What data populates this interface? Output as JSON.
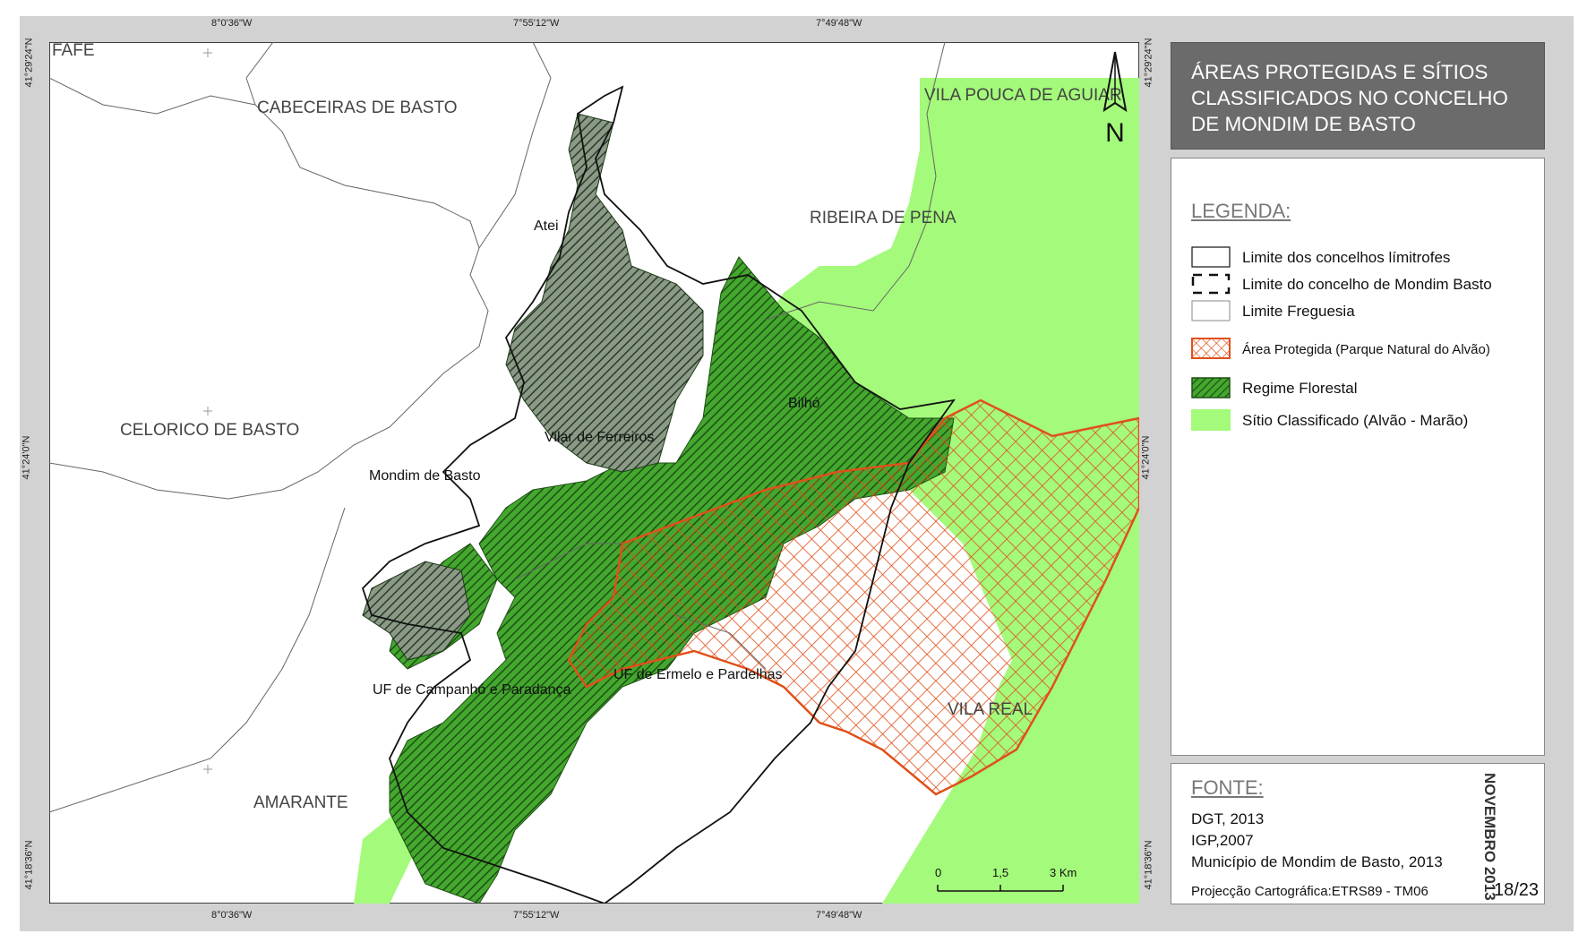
{
  "title": "ÁREAS PROTEGIDAS E SÍTIOS CLASSIFICADOS NO CONCELHO DE MONDIM DE BASTO",
  "coords": {
    "top": [
      "8°0'36\"W",
      "7°55'12\"W",
      "7°49'48\"W"
    ],
    "bottom": [
      "8°0'36\"W",
      "7°55'12\"W",
      "7°49'48\"W"
    ],
    "left": [
      "41°29'24\"N",
      "41°24'0\"N",
      "41°18'36\"N"
    ],
    "right": [
      "41°29'24\"N",
      "41°24'0\"N",
      "41°18'36\"N"
    ]
  },
  "map_labels": {
    "fafe": "FAFE",
    "cabeceiras": "CABECEIRAS DE BASTO",
    "vila_pouca": "VILA POUCA DE AGUIAR",
    "ribeira_pena": "RIBEIRA DE PENA",
    "celorico": "CELORICO DE BASTO",
    "amarante": "AMARANTE",
    "vila_real": "VILA REAL",
    "atei": "Atei",
    "bilho": "Bilhó",
    "vilar": "Vilar de Ferreiros",
    "mondim": "Mondim de Basto",
    "campanho": "UF de Campanhó e Paradança",
    "ermelo": "UF de Ermelo e Pardelhas"
  },
  "north_arrow": "N",
  "scale_bar": {
    "labels": [
      "0",
      "1,5",
      "3 Km"
    ]
  },
  "legend": {
    "title": "LEGENDA:",
    "items": [
      {
        "label": "Limite dos concelhos límitrofes",
        "symbol": "box-solid"
      },
      {
        "label": "Limite do concelho de Mondim Basto",
        "symbol": "box-dashed"
      },
      {
        "label": "Limite Freguesia",
        "symbol": "box-thin"
      },
      {
        "label": "Área Protegida (Parque Natural do Alvão)",
        "symbol": "crosshatch-orange"
      },
      {
        "label": "Regime Florestal",
        "symbol": "hatch-green"
      },
      {
        "label": "Sítio Classificado (Alvão - Marão)",
        "symbol": "fill-lightgreen"
      }
    ]
  },
  "colors": {
    "protected_area": "#e0501a",
    "forest_regime": "#3f8f2c",
    "classified_site": "#a4fa7a"
  },
  "sources": {
    "title": "FONTE:",
    "lines": [
      "DGT, 2013",
      "IGP,2007",
      "Município de Mondim de Basto, 2013"
    ],
    "projection": "Projecção Cartográfica:ETRS89 - TM06",
    "date": "NOVEMBRO 2013",
    "sheet": "18/23"
  }
}
